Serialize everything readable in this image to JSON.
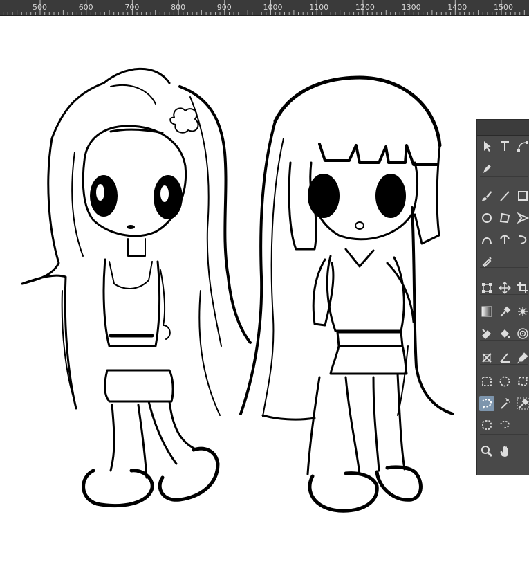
{
  "ruler": {
    "labels": [
      "500",
      "600",
      "700",
      "800",
      "900",
      "1000",
      "1100",
      "1200",
      "1300",
      "1400",
      "1500"
    ]
  },
  "colors": {
    "ruler_bg": "#3a3a3a",
    "toolbox_bg": "#494949",
    "active_tool": "#7d95ad",
    "ink": "#000000"
  },
  "toolbox": {
    "tools": [
      "select-arrow-icon",
      "text-tool-icon",
      "node-tool-icon",
      "pen-tool-icon",
      "brush-icon",
      "line-icon",
      "rectangle-icon",
      "ellipse-icon",
      "polygon-icon",
      "arrow-shape-icon",
      "arc-icon",
      "bezier-icon",
      "curve-icon",
      "airbrush-icon",
      "transform-icon",
      "move-icon",
      "crop-icon",
      "gradient-icon",
      "eyedropper-icon",
      "sparkle-icon",
      "eraser-icon",
      "fill-bucket-icon",
      "target-icon",
      "perspective-icon",
      "angle-icon",
      "pin-icon",
      "rect-select-icon",
      "ellipse-select-icon",
      "poly-select-icon",
      "lasso-select-icon",
      "magic-wand-icon",
      "color-select-icon",
      "brush-select-icon",
      "free-select-icon",
      "zoom-icon",
      "hand-icon"
    ],
    "active_tool": "lasso-select-icon"
  }
}
